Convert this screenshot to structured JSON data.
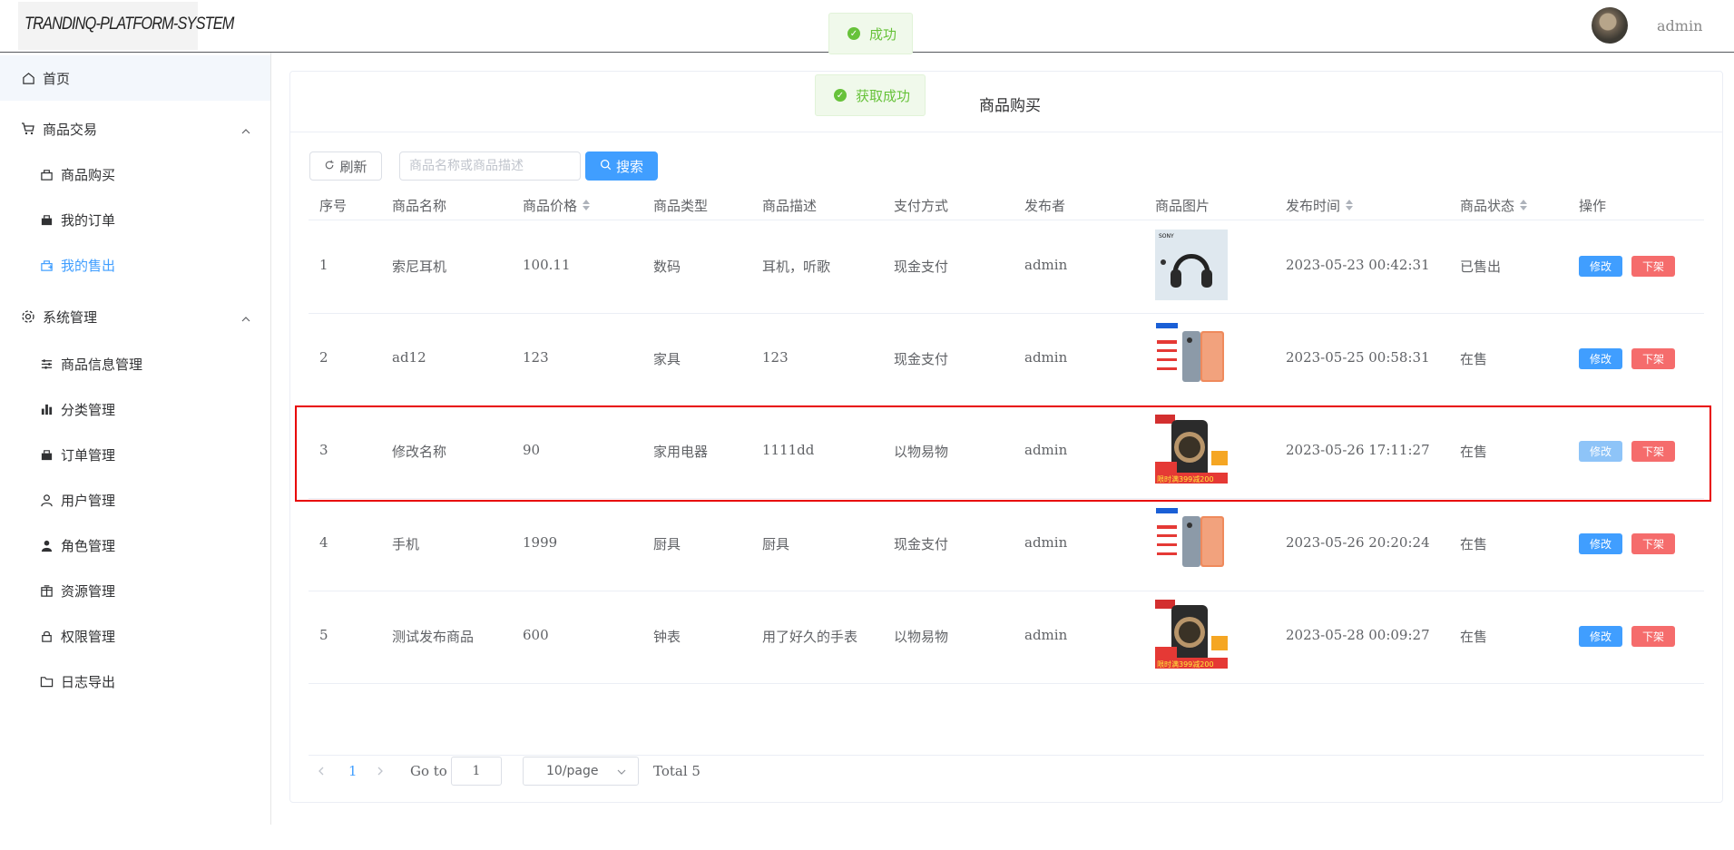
{
  "header": {
    "logo_text": "TRANDINQ-PLATFORM-SYSTEM",
    "user_name": "admin"
  },
  "toasts": [
    {
      "text": "成功"
    },
    {
      "text": "获取成功"
    }
  ],
  "sidebar": {
    "items": [
      {
        "label": "首页",
        "icon": "home-icon"
      },
      {
        "label": "商品交易",
        "icon": "cart-icon",
        "expanded": true
      },
      {
        "label": "商品购买",
        "icon": "bag-icon"
      },
      {
        "label": "我的订单",
        "icon": "bag-filled-icon"
      },
      {
        "label": "我的售出",
        "icon": "sold-icon",
        "selected": true
      },
      {
        "label": "系统管理",
        "icon": "gear-icon",
        "expanded": true
      },
      {
        "label": "商品信息管理",
        "icon": "sliders-icon"
      },
      {
        "label": "分类管理",
        "icon": "bar-chart-icon"
      },
      {
        "label": "订单管理",
        "icon": "bag-filled-icon"
      },
      {
        "label": "用户管理",
        "icon": "user-icon"
      },
      {
        "label": "角色管理",
        "icon": "user-filled-icon"
      },
      {
        "label": "资源管理",
        "icon": "box-icon"
      },
      {
        "label": "权限管理",
        "icon": "lock-icon"
      },
      {
        "label": "日志导出",
        "icon": "folder-icon"
      }
    ]
  },
  "main": {
    "title": "商品购买",
    "refresh_label": "刷新",
    "search_placeholder": "商品名称或商品描述",
    "search_label": "搜索",
    "columns": [
      "序号",
      "商品名称",
      "商品价格",
      "商品类型",
      "商品描述",
      "支付方式",
      "发布者",
      "商品图片",
      "发布时间",
      "商品状态",
      "操作"
    ],
    "edit_label": "修改",
    "offshelf_label": "下架",
    "rows": [
      {
        "no": "1",
        "name": "索尼耳机",
        "price": "100.11",
        "type": "数码",
        "desc": "耳机，听歌",
        "pay": "现金支付",
        "publisher": "admin",
        "image": "headphones",
        "time": "2023-05-23 00:42:31",
        "status": "已售出"
      },
      {
        "no": "2",
        "name": "ad12",
        "price": "123",
        "type": "家具",
        "desc": "123",
        "pay": "现金支付",
        "publisher": "admin",
        "image": "phone",
        "time": "2023-05-25 00:58:31",
        "status": "在售"
      },
      {
        "no": "3",
        "name": "修改名称",
        "price": "90",
        "type": "家用电器",
        "desc": "1111dd",
        "pay": "以物易物",
        "publisher": "admin",
        "image": "watch",
        "time": "2023-05-26 17:11:27",
        "status": "在售"
      },
      {
        "no": "4",
        "name": "手机",
        "price": "1999",
        "type": "厨具",
        "desc": "厨具",
        "pay": "现金支付",
        "publisher": "admin",
        "image": "phone",
        "time": "2023-05-26 20:20:24",
        "status": "在售"
      },
      {
        "no": "5",
        "name": "测试发布商品",
        "price": "600",
        "type": "钟表",
        "desc": "用了好久的手表",
        "pay": "以物易物",
        "publisher": "admin",
        "image": "watch",
        "time": "2023-05-28 00:09:27",
        "status": "在售"
      }
    ]
  },
  "pagination": {
    "current_page": "1",
    "goto_label": "Go to",
    "goto_value": "1",
    "page_size": "10/page",
    "total": "Total 5"
  },
  "colors": {
    "primary": "#409eff",
    "danger": "#f56c6c",
    "success": "#67c23a",
    "highlight": "#e80000"
  }
}
